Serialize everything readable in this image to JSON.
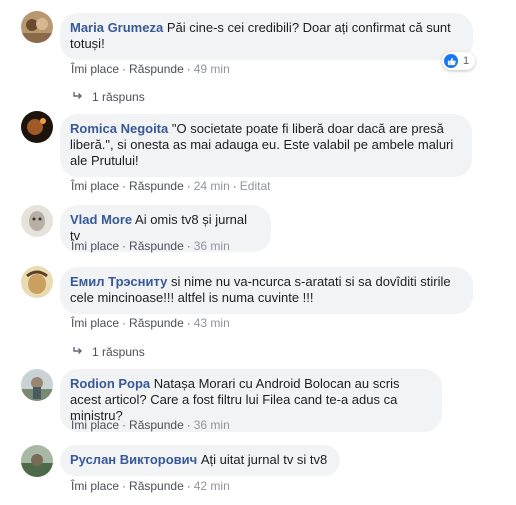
{
  "actions": {
    "like": "Îmi place",
    "reply": "Răspunde",
    "edited": "Editat",
    "separator": "·"
  },
  "comments": [
    {
      "author": "Maria Grumeza",
      "text": "Păi cine-s cei credibili? Doar ați confirmat că sunt totuși!",
      "time": "49 min",
      "reactions": "1",
      "replies": "1 răspuns",
      "avatar_color": "#8a6a4a"
    },
    {
      "author": "Romica Negoita",
      "text": "\"O societate poate fi liberă doar dacă are presă liberă.\", si onesta as mai adauga eu. Este valabil pe ambele maluri ale Prutului!",
      "time": "24 min",
      "edited": true,
      "avatar_color": "#3a2a1e"
    },
    {
      "author": "Vlad More",
      "text": "Ai omis tv8 și jurnal tv",
      "time": "36 min",
      "avatar_color": "#cfc9c0"
    },
    {
      "author": "Емил Трэсниту",
      "text": "si nime nu va-ncurca s-aratati si sa dovîditi stirile cele mincinoase!!! altfel is numa cuvinte !!!",
      "time": "43 min",
      "replies": "1 răspuns",
      "avatar_color": "#c9b27a"
    },
    {
      "author": "Rodion Popa",
      "text": "Natașa Morari cu Android Bolocan au scris acest articol? Care a fost filtru lui Filea cand te-a adus ca ministru?",
      "time": "36 min",
      "avatar_color": "#9aa7a0"
    },
    {
      "author": "Руслан Викторович",
      "text": "Ați uitat jurnal tv si tv8",
      "time": "42 min",
      "avatar_color": "#6f8a6a"
    }
  ]
}
